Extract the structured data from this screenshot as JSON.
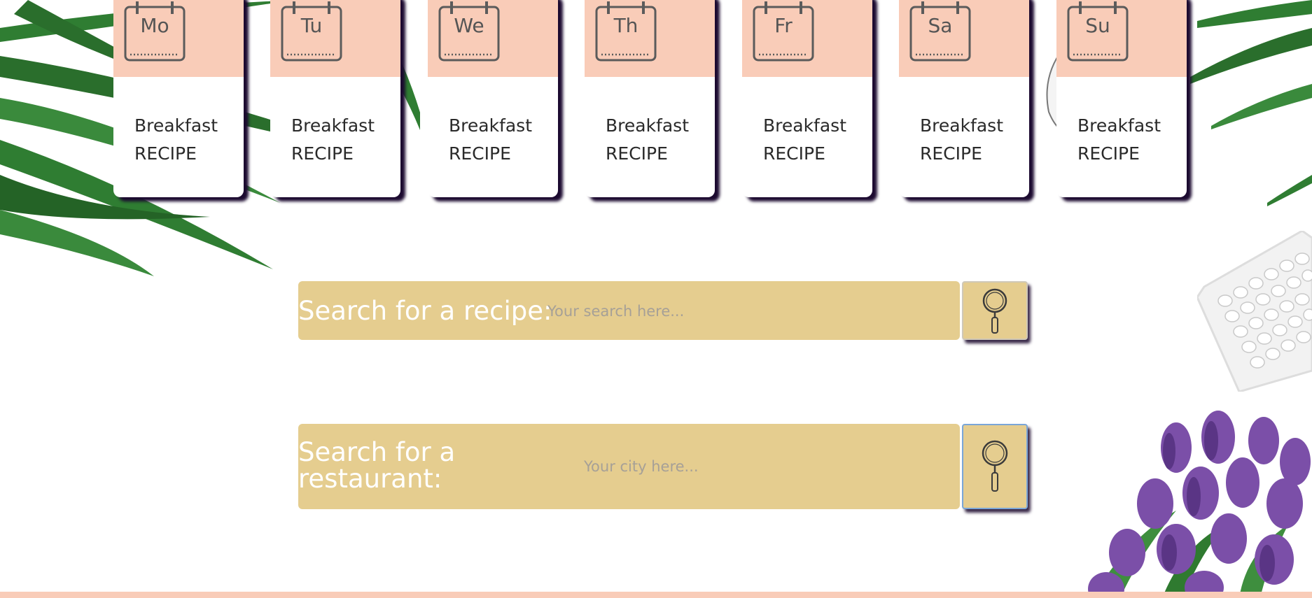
{
  "week": {
    "days": [
      {
        "abbr": "Mo",
        "meal": "Breakfast",
        "kind": "RECIPE"
      },
      {
        "abbr": "Tu",
        "meal": "Breakfast",
        "kind": "RECIPE"
      },
      {
        "abbr": "We",
        "meal": "Breakfast",
        "kind": "RECIPE"
      },
      {
        "abbr": "Th",
        "meal": "Breakfast",
        "kind": "RECIPE"
      },
      {
        "abbr": "Fr",
        "meal": "Breakfast",
        "kind": "RECIPE"
      },
      {
        "abbr": "Sa",
        "meal": "Breakfast",
        "kind": "RECIPE"
      },
      {
        "abbr": "Su",
        "meal": "Breakfast",
        "kind": "RECIPE"
      }
    ]
  },
  "recipe_search": {
    "label": "Search for a recipe:",
    "placeholder": "Your search here...",
    "button_icon": "magnifier-icon"
  },
  "restaurant_search": {
    "label_line1": "Search for a",
    "label_line2": "restaurant:",
    "placeholder": "Your city here...",
    "button_icon": "magnifier-icon"
  },
  "colors": {
    "card_header": "#f9ccb8",
    "search_bar": "#e5cd8f",
    "card_shadow": "#1c0a30",
    "label_text": "#ffffff"
  }
}
